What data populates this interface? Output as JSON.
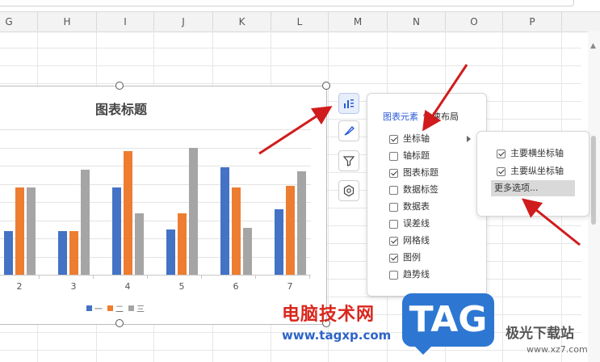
{
  "columns": [
    "G",
    "H",
    "I",
    "J",
    "K",
    "L",
    "M",
    "N",
    "O",
    "P"
  ],
  "chart": {
    "title": "图表标题",
    "legend": [
      "一",
      "二",
      "三"
    ],
    "colors": {
      "series1": "#4472c4",
      "series2": "#ed7d31",
      "series3": "#a5a5a5"
    }
  },
  "chart_data": {
    "type": "bar",
    "title": "图表标题",
    "categories": [
      "2",
      "3",
      "4",
      "5",
      "6",
      "7"
    ],
    "series": [
      {
        "name": "一",
        "values": [
          2.4,
          2.4,
          4.8,
          2.5,
          5.9,
          3.6
        ]
      },
      {
        "name": "二",
        "values": [
          4.8,
          2.4,
          6.8,
          3.4,
          4.8,
          4.9
        ]
      },
      {
        "name": "三",
        "values": [
          4.8,
          5.8,
          3.4,
          7.0,
          2.6,
          5.7
        ]
      }
    ],
    "ylim": [
      0,
      8
    ],
    "grid": true,
    "legend_position": "bottom"
  },
  "side_buttons": [
    "chart-elements-icon",
    "style-brush-icon",
    "filter-icon",
    "settings-hexagon-icon"
  ],
  "panel": {
    "tab_active": "图表元素",
    "tab_other": "快速布局",
    "items": [
      {
        "label": "坐标轴",
        "checked": true
      },
      {
        "label": "轴标题",
        "checked": false
      },
      {
        "label": "图表标题",
        "checked": true
      },
      {
        "label": "数据标签",
        "checked": false
      },
      {
        "label": "数据表",
        "checked": false
      },
      {
        "label": "误差线",
        "checked": false
      },
      {
        "label": "网格线",
        "checked": true
      },
      {
        "label": "图例",
        "checked": true
      },
      {
        "label": "趋势线",
        "checked": false
      }
    ]
  },
  "submenu": {
    "items": [
      {
        "label": "主要横坐标轴",
        "checked": true
      },
      {
        "label": "主要纵坐标轴",
        "checked": true
      }
    ],
    "more": "更多选项..."
  },
  "watermark": {
    "site_cn": "电脑技术网",
    "site_url": "www.tagxp.com",
    "logo": "TAG",
    "right_cn": "极光下载站",
    "right_url": "www.xz7.com"
  }
}
